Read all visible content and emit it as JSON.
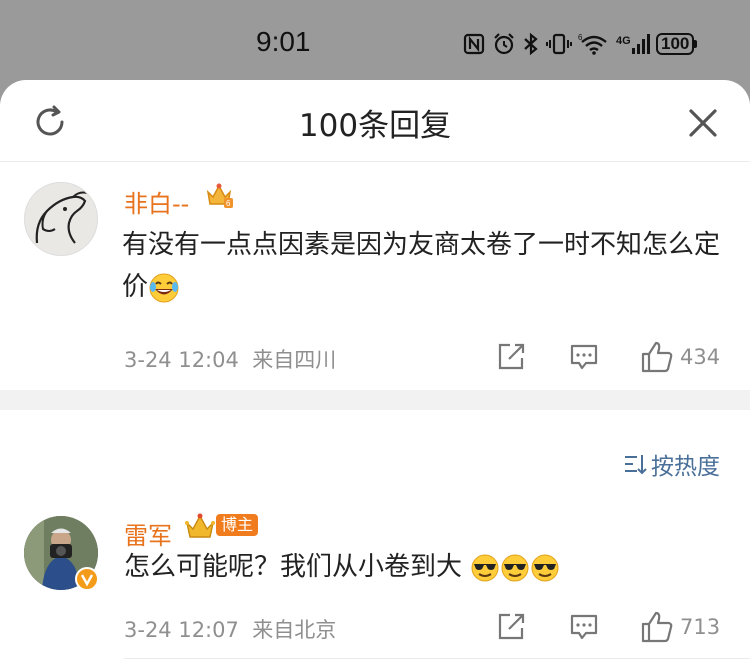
{
  "status_bar": {
    "time": "9:01",
    "battery": "100",
    "network": "4G",
    "icons": [
      "nfc-icon",
      "alarm-icon",
      "bluetooth-icon",
      "vibrate-icon",
      "wifi-icon",
      "signal-icon",
      "battery-icon"
    ]
  },
  "sheet": {
    "title": "100条回复",
    "refresh_icon": "refresh-icon",
    "close_icon": "close-icon"
  },
  "comments": [
    {
      "username": "非白--",
      "text": "有没有一点点因素是因为友商太卷了一时不知怎么定价",
      "emoji": "laughing-tears-emoji",
      "date": "3-24 12:04",
      "location": "来自四川",
      "likes": "434"
    },
    {
      "username": "雷军",
      "badge": "博主",
      "text": "怎么可能呢？我们从小卷到大",
      "emoji": "sunglasses-emoji",
      "date": "3-24 12:07",
      "location": "来自北京",
      "likes": "713"
    }
  ],
  "sort": {
    "label": "按热度"
  },
  "colors": {
    "username": "#e8731d",
    "meta": "#8f8f8f",
    "sort": "#4a6f98",
    "status_bar_bg": "#9a9a9a"
  }
}
